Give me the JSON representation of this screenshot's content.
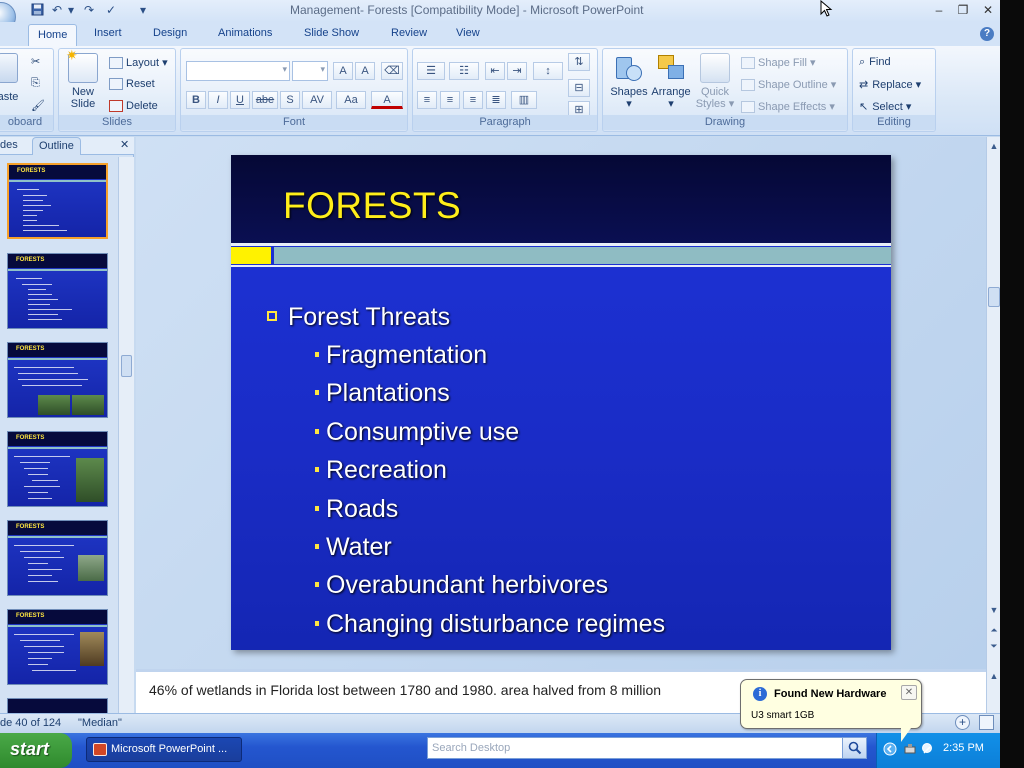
{
  "window": {
    "title": "Management- Forests [Compatibility Mode] - Microsoft PowerPoint"
  },
  "tabs": [
    {
      "label": "Home"
    },
    {
      "label": "Insert"
    },
    {
      "label": "Design"
    },
    {
      "label": "Animations"
    },
    {
      "label": "Slide Show"
    },
    {
      "label": "Review"
    },
    {
      "label": "View"
    }
  ],
  "ribbon": {
    "clipboard": {
      "label": "oboard",
      "paste": "aste"
    },
    "slides": {
      "label": "Slides",
      "new_slide_1": "New",
      "new_slide_2": "Slide",
      "layout": "Layout",
      "reset": "Reset",
      "delete": "Delete"
    },
    "font": {
      "label": "Font",
      "font_name_value": "",
      "font_size_value": "",
      "bold": "B",
      "italic": "I",
      "underline": "U",
      "strike": "abe",
      "shadow": "S",
      "spacing": "AV",
      "case": "Aa",
      "grow": "A",
      "shrink": "A",
      "color": "A"
    },
    "paragraph": {
      "label": "Paragraph"
    },
    "drawing": {
      "label": "Drawing",
      "shapes": "Shapes",
      "arrange": "Arrange",
      "quick_styles_1": "Quick",
      "quick_styles_2": "Styles",
      "shape_fill": "Shape Fill",
      "shape_outline": "Shape Outline",
      "shape_effects": "Shape Effects"
    },
    "editing": {
      "label": "Editing",
      "find": "Find",
      "replace": "Replace",
      "select": "Select"
    }
  },
  "left_pane": {
    "tab_slides": "des",
    "tab_outline": "Outline",
    "thumb_title": "FORESTS"
  },
  "slide": {
    "title": "FORESTS",
    "main_bullet": "Forest Threats",
    "sub_bullets": [
      "Fragmentation",
      "Plantations",
      "Consumptive use",
      "Recreation",
      "Roads",
      "Water",
      "Overabundant herbivores",
      "Changing disturbance regimes"
    ]
  },
  "notes": {
    "text": "46% of wetlands in Florida lost between 1780 and 1980.  area halved from 8 million"
  },
  "status": {
    "slide_counter": "de 40 of 124",
    "theme": "\"Median\""
  },
  "taskbar": {
    "start_label": "start",
    "task_label": "Microsoft PowerPoint ...",
    "search_placeholder": "Search Desktop",
    "clock": "2:35 PM"
  },
  "balloon": {
    "title": "Found New Hardware",
    "message": "U3 smart 1GB"
  },
  "colors": {
    "slide_bg": "#1a2cc6",
    "title_yellow": "#ffee1a",
    "accent_teal": "#8fbcc3",
    "selected_thumb_border": "#f6a12b"
  }
}
